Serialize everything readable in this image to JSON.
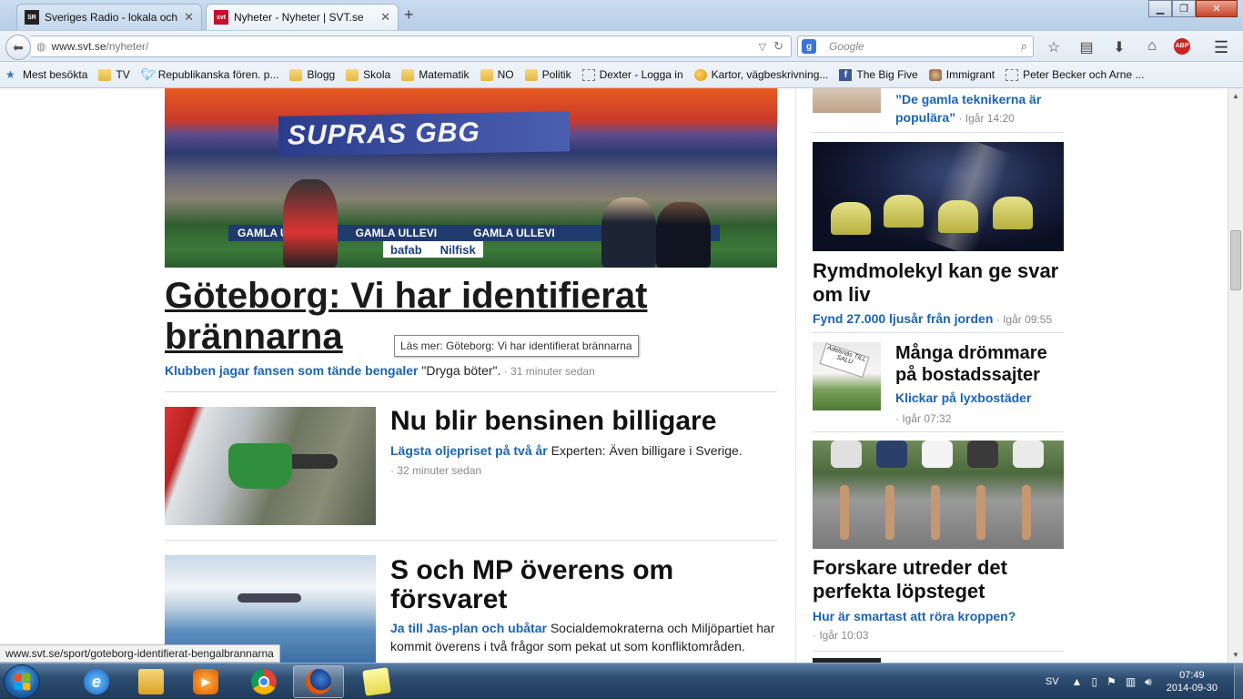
{
  "browser": {
    "tabs": [
      {
        "favicon": "SR",
        "title": "Sveriges Radio - lokala och...",
        "active": false
      },
      {
        "favicon": "svt",
        "title": "Nyheter - Nyheter | SVT.se",
        "active": true
      }
    ],
    "new_tab": "+",
    "url_domain": "www.svt.se",
    "url_path": "/nyheter/",
    "search_placeholder": "Google",
    "bookmarks": [
      {
        "icon": "star-icon",
        "label": "Mest besökta"
      },
      {
        "icon": "folder-icon",
        "label": "TV"
      },
      {
        "icon": "twitter-icon",
        "label": "Republikanska fören. p..."
      },
      {
        "icon": "folder-icon",
        "label": "Blogg"
      },
      {
        "icon": "folder-icon",
        "label": "Skola"
      },
      {
        "icon": "folder-icon",
        "label": "Matematik"
      },
      {
        "icon": "folder-icon",
        "label": "NO"
      },
      {
        "icon": "folder-icon",
        "label": "Politik"
      },
      {
        "icon": "page-icon",
        "label": "Dexter - Logga in"
      },
      {
        "icon": "globe-icon",
        "label": "Kartor, vägbeskrivning..."
      },
      {
        "icon": "facebook-icon",
        "label": "The Big Five"
      },
      {
        "icon": "face-icon",
        "label": "Immigrant"
      },
      {
        "icon": "page-icon",
        "label": "Peter Becker och Arne ..."
      }
    ],
    "status_url": "www.svt.se/sport/goteborg-identifierat-bengalbrannarna"
  },
  "main": {
    "hero": {
      "banner_text": "SUPRAS GBG",
      "ad_texts": [
        "GAMLA ULLEVI",
        "GAMLA ULLEVI",
        "GAMLA ULLEVI"
      ],
      "ad_texts2": [
        "bafab",
        "Nilfisk"
      ],
      "headline": "Göteborg: Vi har identifierat brännarna",
      "tooltip": "Läs mer: Göteborg: Vi har identifierat brännarna",
      "lead": "Klubben jagar fansen som tände bengaler",
      "text": " \"Dryga böter\".",
      "time": " · 31 minuter sedan"
    },
    "articles": [
      {
        "headline": "Nu blir bensinen billigare",
        "lead": "Lägsta oljepriset på två år",
        "text": " Experten: Även billigare i Sverige.",
        "time": "· 32 minuter sedan"
      },
      {
        "headline": "S och MP överens om försvaret",
        "lead": "Ja till Jas-plan och ubåtar",
        "text": " Socialdemokraterna och Miljöpartiet har kommit överens i två frågor som pekat ut som konfliktområden."
      }
    ]
  },
  "sidebar": {
    "top": {
      "quote": "”De gamla teknikerna är populära”",
      "time": " · Igår 14:20"
    },
    "items": [
      {
        "headline": "Rymdmolekyl kan ge svar om liv",
        "lead": "Fynd 27.000 ljusår från jorden",
        "time": " · Igår 09:55"
      },
      {
        "headline": "Många drömmare på bostadssajter",
        "lead": "Klickar på lyxbostäder",
        "time": "· Igår 07:32",
        "sign_text": "Adelsnäs TILL SALU"
      },
      {
        "headline": "Forskare utreder det perfekta löpsteget",
        "lead": "Hur är smartast att röra kroppen?",
        "time": "· Igår 10:03"
      }
    ]
  },
  "taskbar": {
    "lang": "SV",
    "time": "07:49",
    "date": "2014-09-30"
  },
  "colors": {
    "link_blue": "#1a63b3",
    "headline": "#111111"
  }
}
